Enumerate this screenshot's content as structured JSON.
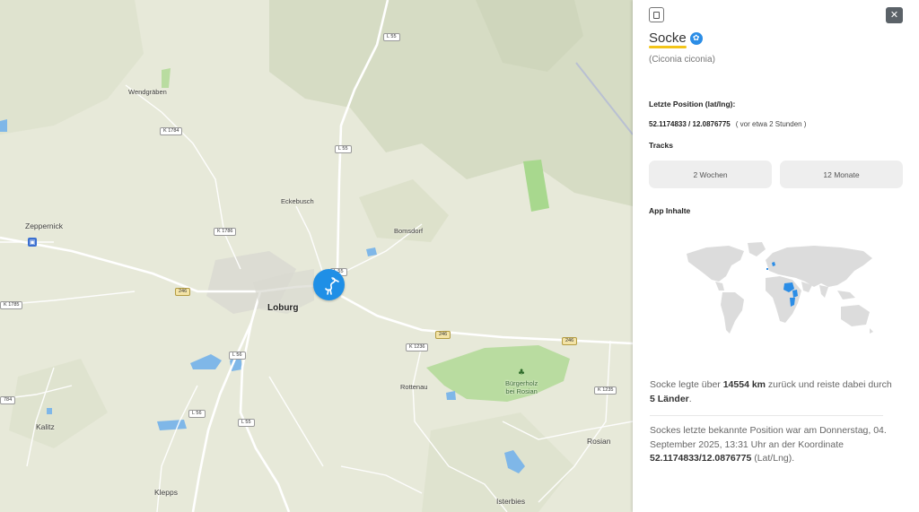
{
  "map": {
    "places": {
      "wendgraeben": "Wendgräben",
      "zeppernick": "Zeppernick",
      "eckebusch": "Eckebusch",
      "bomsdorf": "Bomsdorf",
      "loburg": "Loburg",
      "rottenau": "Rottenau",
      "buergerholz_1": "Bürgerholz",
      "buergerholz_2": "bei Rosian",
      "kalitz": "Kalitz",
      "klepps": "Klepps",
      "rosian": "Rosian",
      "isterbies": "Isterbies"
    },
    "shields": {
      "l55_top": "L 55",
      "k1784": "K 1784",
      "l55_mid": "L 55",
      "k1786": "K 1786",
      "l55_loburg": "L 55",
      "r246_left": "246",
      "k1785": "K 1785",
      "r246_mid": "246",
      "r246_right": "246",
      "k1236": "K 1236",
      "l56": "L 56",
      "k1235": "K 1235",
      "l56_low": "L 56",
      "l55_low": "L 55",
      "k784": "784"
    },
    "marker_icon": "stork-icon",
    "bus_icon": "bus-stop-icon",
    "tree_icon": "tree-icon"
  },
  "panel": {
    "name": "Socke",
    "latin": "(Ciconia ciconia)",
    "last_position_label": "Letzte Position (lat/lng):",
    "coords": "52.1174833 / 12.0876775",
    "coords_ago": "( vor etwa 2 Stunden )",
    "tracks_label": "Tracks",
    "track_2w": "2 Wochen",
    "track_12m": "12 Monate",
    "app_label": "App Inhalte",
    "summary1": {
      "a": "Socke legte über ",
      "km": "14554 km",
      "b": " zurück und reiste dabei durch ",
      "countries": "5 Länder",
      "c": "."
    },
    "summary2": {
      "a": "Sockes letzte bekannte Position war am Donnerstag, 04. September 2025, 13:31 Uhr an der Koordinate ",
      "coords": "52.1174833/12.0876775",
      "b": " (Lat/Lng)."
    },
    "close_symbol": "✕",
    "verified_symbol": "✿"
  },
  "colors": {
    "accent": "#1f8fe6",
    "underline": "#f3c519",
    "highlight_countries": "#2b8de6"
  }
}
